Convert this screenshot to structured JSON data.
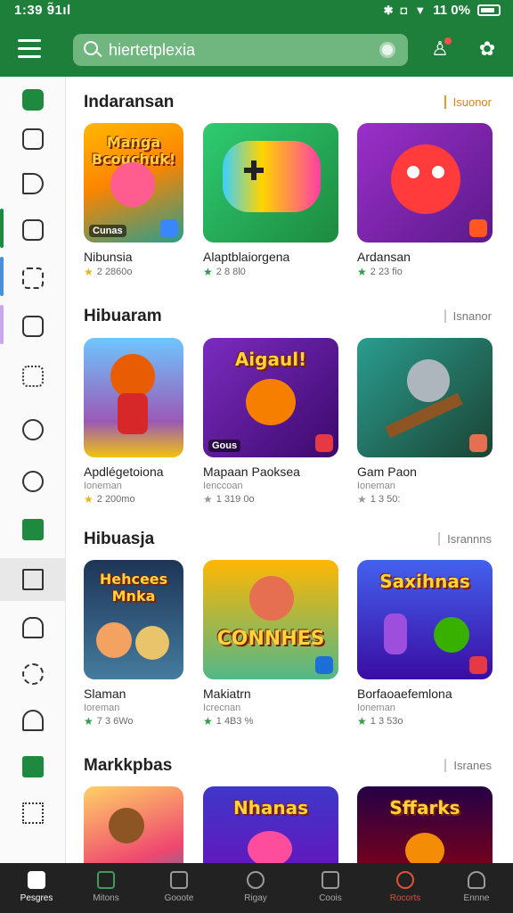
{
  "status": {
    "time": "1:39 9̃1ıl",
    "battery_text": "11 0%",
    "icons": [
      "bluetooth-icon",
      "alarm-icon",
      "wifi-icon",
      "battery-icon"
    ]
  },
  "appbar": {
    "search_text": "hiertetplexia",
    "icons": [
      "menu-icon",
      "search-icon",
      "lens-icon",
      "account-icon",
      "settings-icon"
    ]
  },
  "rail": {
    "items": [
      {
        "icon": "folder-plus-icon"
      },
      {
        "icon": "document-icon"
      },
      {
        "icon": "play-icon"
      },
      {
        "icon": "bag-icon"
      },
      {
        "icon": "puzzle-icon"
      },
      {
        "icon": "camera-icon"
      },
      {
        "icon": "grid-icon"
      },
      {
        "icon": "emoji-icon"
      },
      {
        "icon": "clock-icon"
      },
      {
        "icon": "table-icon"
      },
      {
        "icon": "equalizer-icon"
      },
      {
        "icon": "home-icon"
      },
      {
        "icon": "refresh-icon"
      },
      {
        "icon": "house-outline-icon"
      },
      {
        "icon": "card-icon"
      },
      {
        "icon": "share-icon"
      }
    ]
  },
  "sections": [
    {
      "title": "Indaransan",
      "link": "Isuonor",
      "cards": [
        {
          "name": "Nibunsia",
          "sub": "",
          "rating": "2 2860o",
          "thumb_title": "Manga Bcouchuk!",
          "badge": "Cunas"
        },
        {
          "name": "Alaptblaiorgena",
          "sub": "",
          "rating": "2 8 8l0",
          "thumb_title": "",
          "badge": ""
        },
        {
          "name": "Ardansan",
          "sub": "",
          "rating": "2 23 fio",
          "thumb_title": "",
          "badge": ""
        }
      ]
    },
    {
      "title": "Hibuaram",
      "link": "Isnanor",
      "cards": [
        {
          "name": "Apdlégetoiona",
          "sub": "Ioneman",
          "rating": "2 200mo",
          "thumb_title": "",
          "badge": ""
        },
        {
          "name": "Mapaan Paoksea",
          "sub": "Ienccoan",
          "rating": "1 319 0o",
          "thumb_title": "Aigaul!",
          "badge": "Gous"
        },
        {
          "name": "Gam Paon",
          "sub": "Ioneman",
          "rating": "1 3 50:",
          "thumb_title": "",
          "badge": ""
        }
      ]
    },
    {
      "title": "Hibuasja",
      "link": "Isrannns",
      "cards": [
        {
          "name": "Slaman",
          "sub": "Ioreman",
          "rating": "7 3 6Wo",
          "thumb_title": "Hehcees Mnka",
          "badge": ""
        },
        {
          "name": "Makiatrn",
          "sub": "Icrecnan",
          "rating": "1 4B3 %",
          "thumb_title": "CONNHES",
          "badge": ""
        },
        {
          "name": "Borfaoaefemlona",
          "sub": "Ioneman",
          "rating": "1 3 53o",
          "thumb_title": "Saxihnas",
          "badge": ""
        }
      ]
    },
    {
      "title": "Markkpbas",
      "link": "Isranes",
      "cards": [
        {
          "name": "",
          "sub": "",
          "rating": "",
          "thumb_title": "",
          "badge": ""
        },
        {
          "name": "",
          "sub": "",
          "rating": "",
          "thumb_title": "Nhanas",
          "badge": ""
        },
        {
          "name": "",
          "sub": "",
          "rating": "",
          "thumb_title": "Sffarks",
          "badge": ""
        }
      ]
    }
  ],
  "bottom_nav": [
    {
      "label": "Pesgres",
      "icon": "home-icon"
    },
    {
      "label": "Mitons",
      "icon": "apps-icon"
    },
    {
      "label": "Gooote",
      "icon": "calendar-icon"
    },
    {
      "label": "Rigay",
      "icon": "compass-icon"
    },
    {
      "label": "Coois",
      "icon": "chart-icon"
    },
    {
      "label": "Rocorts",
      "icon": "rewards-icon"
    },
    {
      "label": "Ennne",
      "icon": "profile-icon"
    }
  ],
  "colors": {
    "brand": "#1e7f3b",
    "star_gold": "#e8b51a",
    "star_green": "#2e9b4a",
    "accent_orange": "#d4841f"
  }
}
